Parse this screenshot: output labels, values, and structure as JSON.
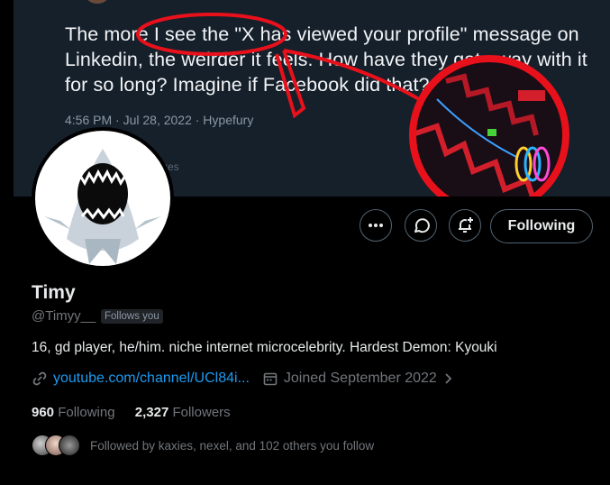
{
  "tweet": {
    "text": "The more I see the \"X has viewed your profile\" message on Linkedin, the weirder it feels. How have they got away with it for so long? Imagine if Facebook did that?",
    "meta": "4:56 PM · Jul 28, 2022 · Hypefury",
    "faint": "xes"
  },
  "profile": {
    "name": "Timy",
    "handle": "@Timyy__",
    "follows_you": "Follows you",
    "bio": "16, gd player, he/him. niche internet microcelebrity. Hardest Demon: Kyouki",
    "link": "youtube.com/channel/UCl84i...",
    "joined": "Joined September 2022",
    "following_count": "960",
    "following_label": "Following",
    "followers_count": "2,327",
    "followers_label": "Followers",
    "followed_by": "Followed by kaxies, nexel, and 102 others you follow"
  },
  "actions": {
    "follow_label": "Following",
    "more_icon": "more-icon",
    "message_icon": "message-icon",
    "notify_icon": "notification-add-icon"
  },
  "colors": {
    "accent": "#1d9bf0",
    "annotation": "#e8111b",
    "banner": "#15202b"
  }
}
